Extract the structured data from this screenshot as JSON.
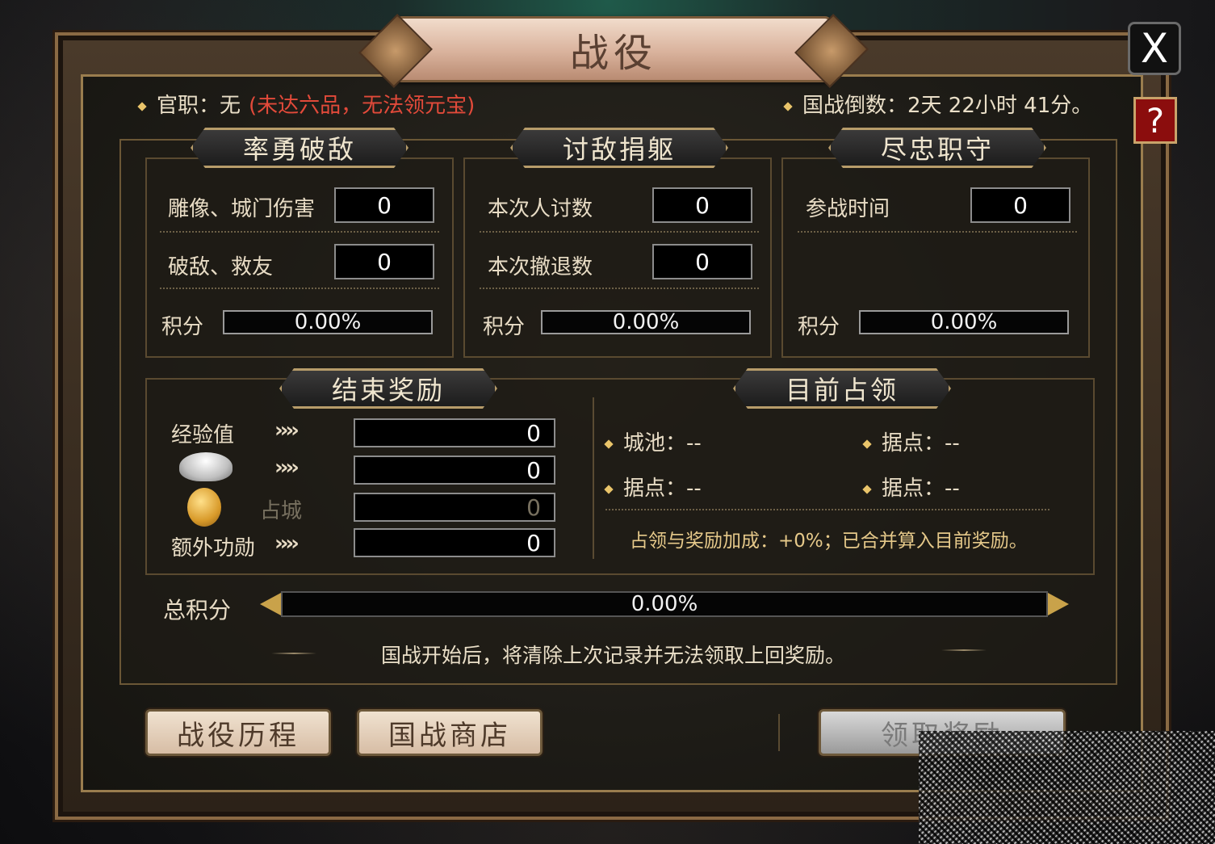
{
  "window": {
    "title": "战役",
    "close_label": "X",
    "help_label": "?"
  },
  "header": {
    "rank_label": "官职：无",
    "rank_warning": "(未达六品，无法领元宝)",
    "countdown": "国战倒数：2天 22小时 41分。"
  },
  "panels": [
    {
      "title": "率勇破敌",
      "rows": [
        {
          "label": "雕像、城门伤害",
          "value": "0"
        },
        {
          "label": "破敌、救友",
          "value": "0"
        }
      ],
      "score_label": "积分",
      "score_pct": "0.00%",
      "score_fraction": 0
    },
    {
      "title": "讨敌捐躯",
      "rows": [
        {
          "label": "本次人讨数",
          "value": "0"
        },
        {
          "label": "本次撤退数",
          "value": "0"
        }
      ],
      "score_label": "积分",
      "score_pct": "0.00%",
      "score_fraction": 0
    },
    {
      "title": "尽忠职守",
      "rows": [
        {
          "label": "参战时间",
          "value": "0"
        }
      ],
      "score_label": "积分",
      "score_pct": "0.00%",
      "score_fraction": 0
    }
  ],
  "rewards": {
    "title": "结束奖励",
    "exp_label": "经验值",
    "arrows": "››››",
    "occupy_label": "占城",
    "extra_label": "额外功勋",
    "values": [
      "0",
      "0",
      "0",
      "0"
    ],
    "icons": [
      "silver-ingot-icon",
      "gold-medal-icon"
    ]
  },
  "occupation": {
    "title": "目前占领",
    "items": [
      "城池：--",
      "据点：--",
      "据点：--",
      "据点：--"
    ],
    "bonus_note": "占领与奖励加成：+0%；已合并算入目前奖励。"
  },
  "total": {
    "label": "总积分",
    "pct": "0.00%",
    "fraction": 0
  },
  "notice": "国战开始后，将清除上次记录并无法领取上回奖励。",
  "buttons": {
    "history": "战役历程",
    "shop": "国战商店",
    "claim": "领取奖励"
  },
  "colors": {
    "warning_red": "#e24a3a",
    "help_red": "#8b0d0d",
    "gold_border": "#b79c6a"
  }
}
